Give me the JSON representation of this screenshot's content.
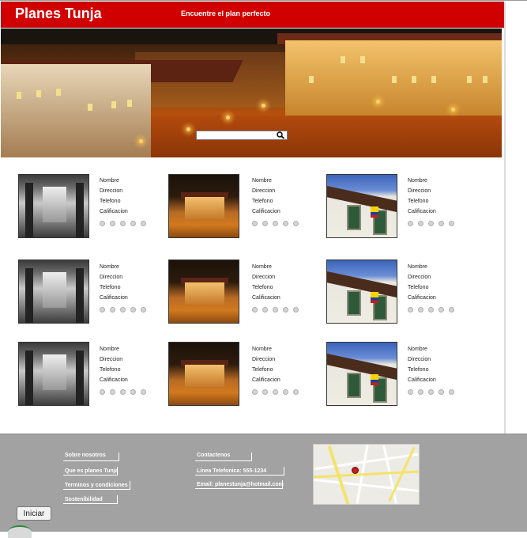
{
  "header": {
    "title": "Planes Tunja",
    "tagline": "Encuentre el plan perfecto"
  },
  "search": {
    "value": "",
    "icon": "search-icon"
  },
  "cards": [
    {
      "image": "interior-hall",
      "fields": [
        "Nombre",
        "Direccion",
        "Telefono",
        "Calificacion"
      ],
      "rating": 0
    },
    {
      "image": "night-street",
      "fields": [
        "Nombre",
        "Direccion",
        "Telefono",
        "Calificacion"
      ],
      "rating": 0
    },
    {
      "image": "colonial-facade",
      "fields": [
        "Nombre",
        "Direccion",
        "Telefono",
        "Calificacion"
      ],
      "rating": 0
    },
    {
      "image": "interior-hall",
      "fields": [
        "Nombre",
        "Direccion",
        "Telefono",
        "Calificacion"
      ],
      "rating": 0
    },
    {
      "image": "night-street",
      "fields": [
        "Nombre",
        "Direccion",
        "Telefono",
        "Calificacion"
      ],
      "rating": 0
    },
    {
      "image": "colonial-facade",
      "fields": [
        "Nombre",
        "Direccion",
        "Telefono",
        "Calificacion"
      ],
      "rating": 0
    },
    {
      "image": "interior-hall",
      "fields": [
        "Nombre",
        "Direccion",
        "Telefono",
        "Calificacion"
      ],
      "rating": 0
    },
    {
      "image": "night-street",
      "fields": [
        "Nombre",
        "Direccion",
        "Telefono",
        "Calificacion"
      ],
      "rating": 0
    },
    {
      "image": "colonial-facade",
      "fields": [
        "Nombre",
        "Direccion",
        "Telefono",
        "Calificacion"
      ],
      "rating": 0
    }
  ],
  "footer": {
    "about": {
      "heading": "Sobre nosotros",
      "links": [
        "Que es planes Tunja",
        "Terminos y condiciones",
        "Sostenibilidad"
      ]
    },
    "contact": {
      "heading": "Contactenos",
      "phone": "Linea Telefonica: 555-1234",
      "email": "Email: planestunja@hotmail.com"
    },
    "login_button": "Iniciar"
  }
}
